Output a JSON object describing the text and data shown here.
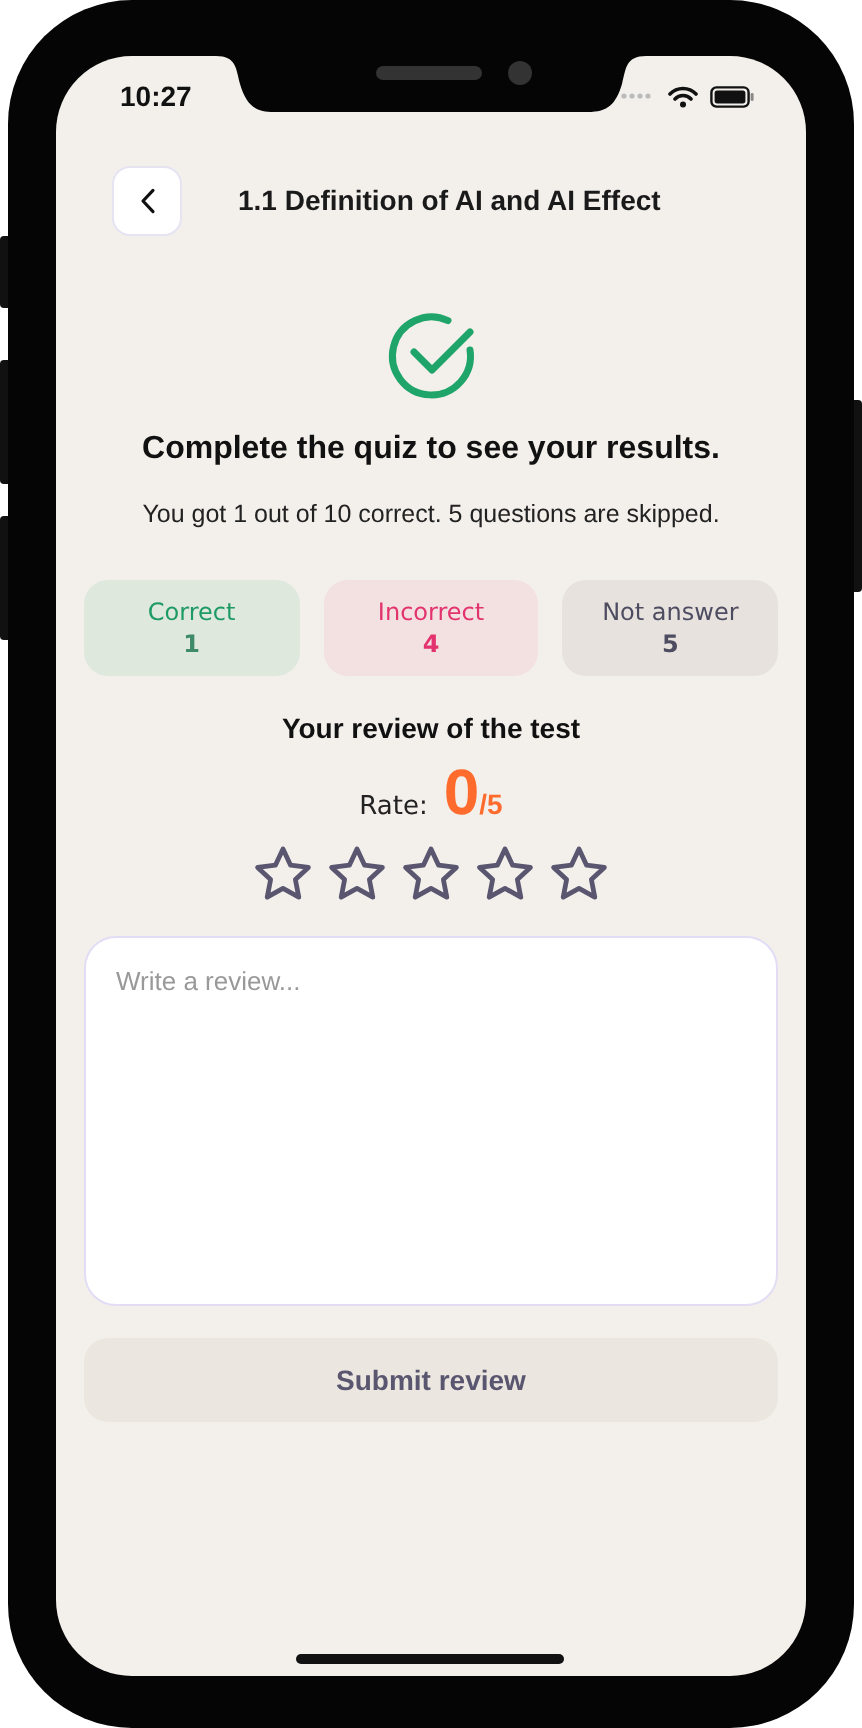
{
  "status_bar": {
    "time": "10:27"
  },
  "header": {
    "title": "1.1 Definition of AI and AI Effect"
  },
  "result": {
    "heading": "Complete the quiz to see your results.",
    "summary": "You got 1 out of 10 correct. 5 questions are skipped."
  },
  "stats": [
    {
      "kind": "correct",
      "label": "Correct",
      "value": "1"
    },
    {
      "kind": "incorrect",
      "label": "Incorrect",
      "value": "4"
    },
    {
      "kind": "skipped",
      "label": "Not answer",
      "value": "5"
    }
  ],
  "review": {
    "title": "Your review of the test",
    "rate_label": "Rate:",
    "score": "0",
    "out_of": "/5",
    "stars": 0,
    "placeholder": "Write a review...",
    "submit": {
      "label": "Submit review",
      "disabled": true
    }
  }
}
